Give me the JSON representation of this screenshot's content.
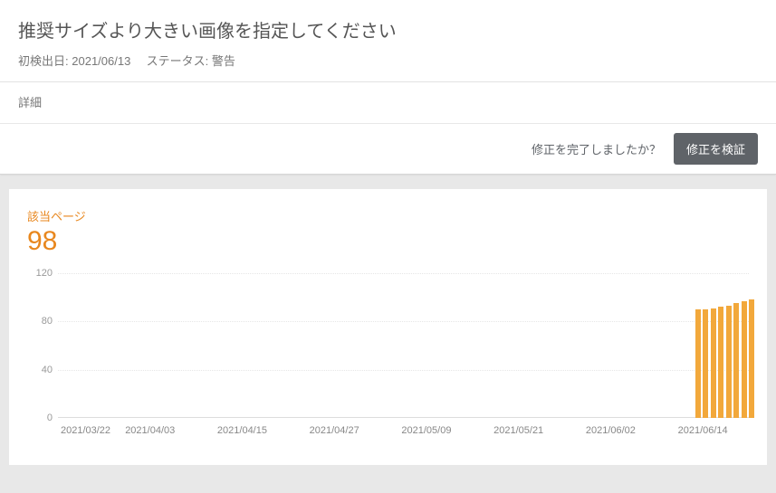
{
  "header": {
    "title": "推奨サイズより大きい画像を指定してください",
    "meta_detected_label": "初検出日:",
    "meta_detected_value": "2021/06/13",
    "meta_status_label": "ステータス:",
    "meta_status_value": "警告",
    "details_link": "詳細"
  },
  "action": {
    "question": "修正を完了しましたか？",
    "button": "修正を検証"
  },
  "metric": {
    "label": "該当ページ",
    "value": "98"
  },
  "chart_data": {
    "type": "bar",
    "title": "",
    "xlabel": "",
    "ylabel": "",
    "ylim": [
      0,
      120
    ],
    "yticks": [
      0,
      40,
      80,
      120
    ],
    "x_tick_labels": [
      "2021/03/22",
      "2021/04/03",
      "2021/04/15",
      "2021/04/27",
      "2021/05/09",
      "2021/05/21",
      "2021/06/02",
      "2021/06/14"
    ],
    "categories": [
      "2021/06/13",
      "2021/06/14",
      "2021/06/15",
      "2021/06/16",
      "2021/06/17",
      "2021/06/18",
      "2021/06/19",
      "2021/06/20"
    ],
    "values": [
      90,
      90,
      91,
      92,
      93,
      95,
      97,
      98
    ],
    "color": "#f2a83b"
  }
}
